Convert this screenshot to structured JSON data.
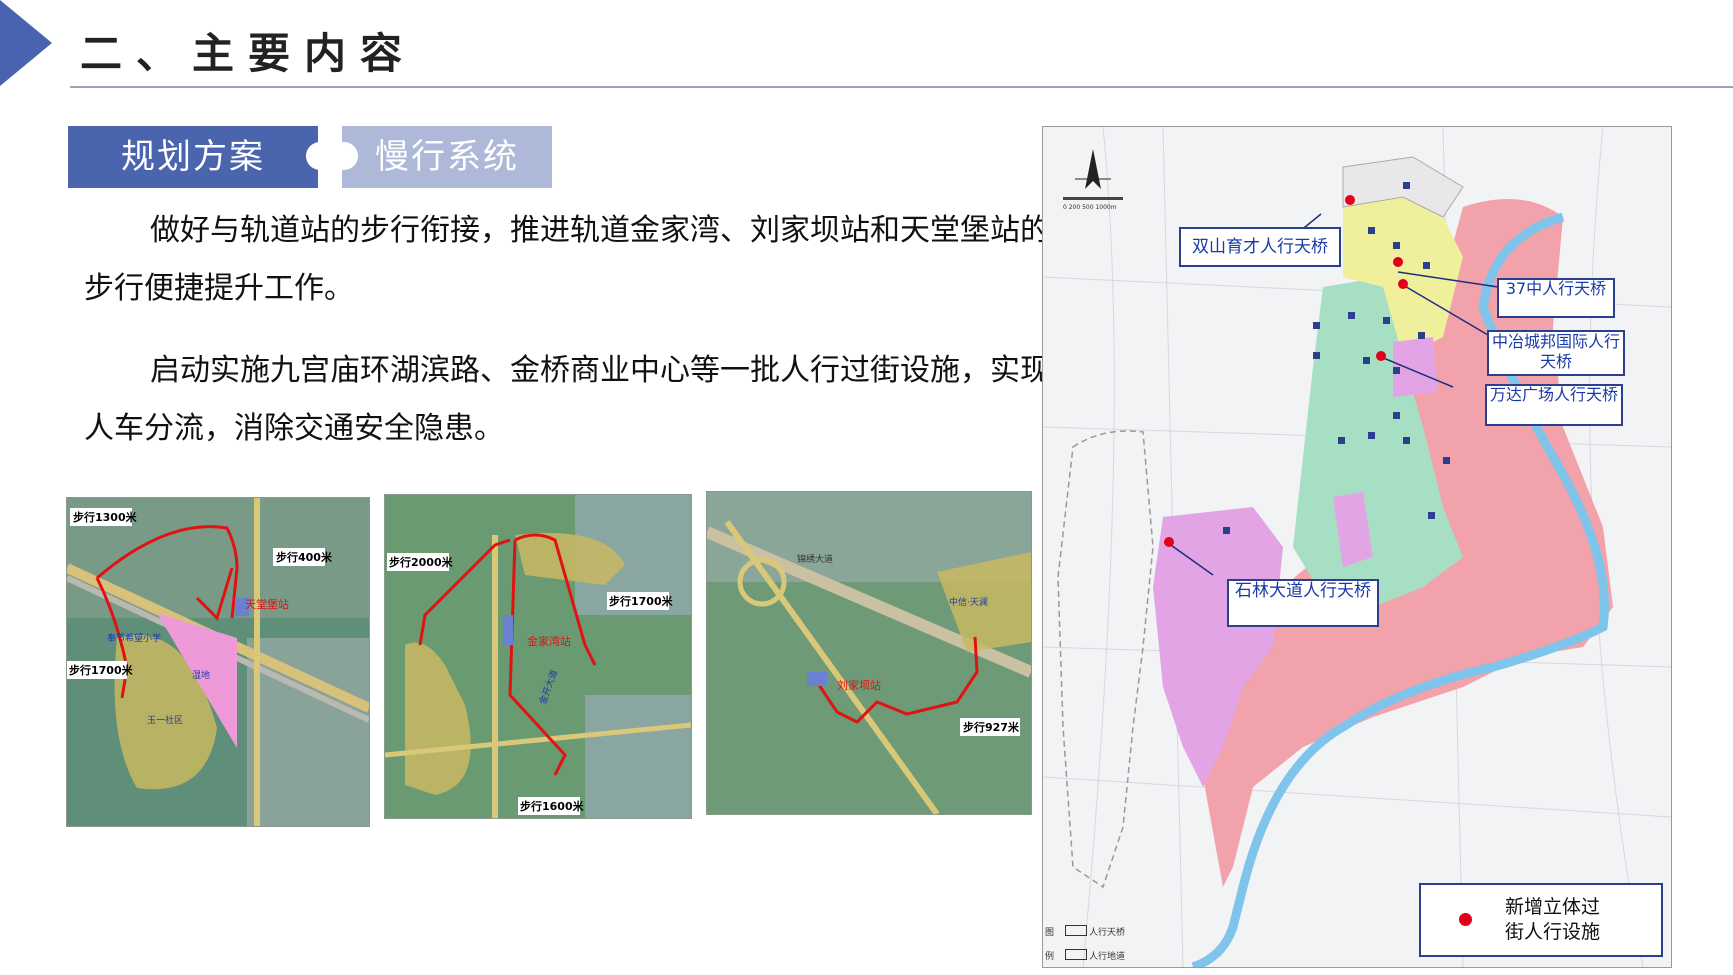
{
  "header": {
    "title": "二、主要内容"
  },
  "tabs": {
    "primary": "规划方案",
    "secondary": "慢行系统"
  },
  "paragraphs": {
    "p1": "做好与轨道站的步行衔接，推进轨道金家湾、刘家坝站和天堂堡站的步行便捷提升工作。",
    "p2": "启动实施九宫庙环湖滨路、金桥商业中心等一批人行过街设施，实现人车分流，消除交通安全隐患。"
  },
  "photo1": {
    "labels": {
      "walk1300": "步行1300米",
      "walk400": "步行400米",
      "walk1700": "步行1700米",
      "station": "天堂堡站",
      "school": "奉节希望小学",
      "area": "玉一社区",
      "park": "湿地"
    }
  },
  "photo2": {
    "labels": {
      "walk2000": "步行2000米",
      "walk1700": "步行1700米",
      "walk1600": "步行1600米",
      "station": "金家湾站",
      "road": "金开大道"
    }
  },
  "photo3": {
    "labels": {
      "station": "刘家坝站",
      "walk927": "步行927米",
      "area": "中信·天澜",
      "road": "锦绣大道"
    }
  },
  "map": {
    "scale_text": "0  200  500    1000m",
    "callouts": {
      "shuangshan": "双山育才人行天桥",
      "no37": "37中人行天桥",
      "zhongye": "中冶城邦国际人行天桥",
      "wanda": "万达广场人行天桥",
      "shilin": "石林大道人行天桥"
    },
    "legend_new": "新增立体过街人行设施",
    "legend_small": {
      "tu": "图",
      "li": "例",
      "item1": "人行天桥",
      "item2": "人行地道"
    },
    "colors": {
      "red_dot": "#e0001a",
      "river": "#7fc4ea",
      "pink": "#f1a2aa",
      "green": "#a6dfc4",
      "yellow": "#f0ef9c",
      "purple": "#e3a4e6"
    }
  }
}
